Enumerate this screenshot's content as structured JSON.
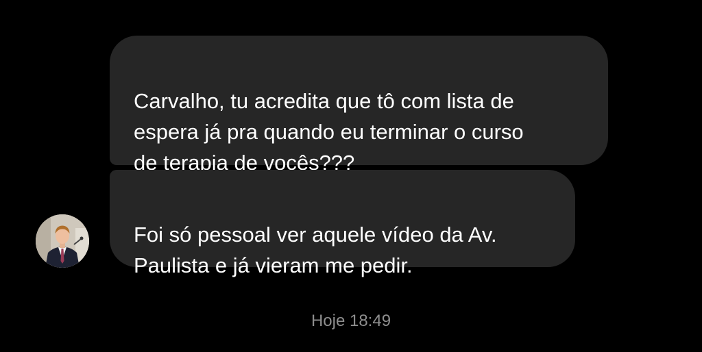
{
  "conversation": {
    "messages": [
      {
        "text": "Carvalho, tu acredita que tô com lista de\nespera já pra quando eu terminar o curso\nde terapia de vocês???"
      },
      {
        "text": "Foi só pessoal ver aquele vídeo da Av.\nPaulista e já vieram me pedir."
      }
    ],
    "sender_avatar_icon": "profile-photo-man-in-suit",
    "timestamp": "Hoje 18:49"
  },
  "colors": {
    "background": "#000000",
    "bubble": "#262626",
    "message_text": "#ffffff",
    "timestamp_text": "#8e8e8e"
  }
}
